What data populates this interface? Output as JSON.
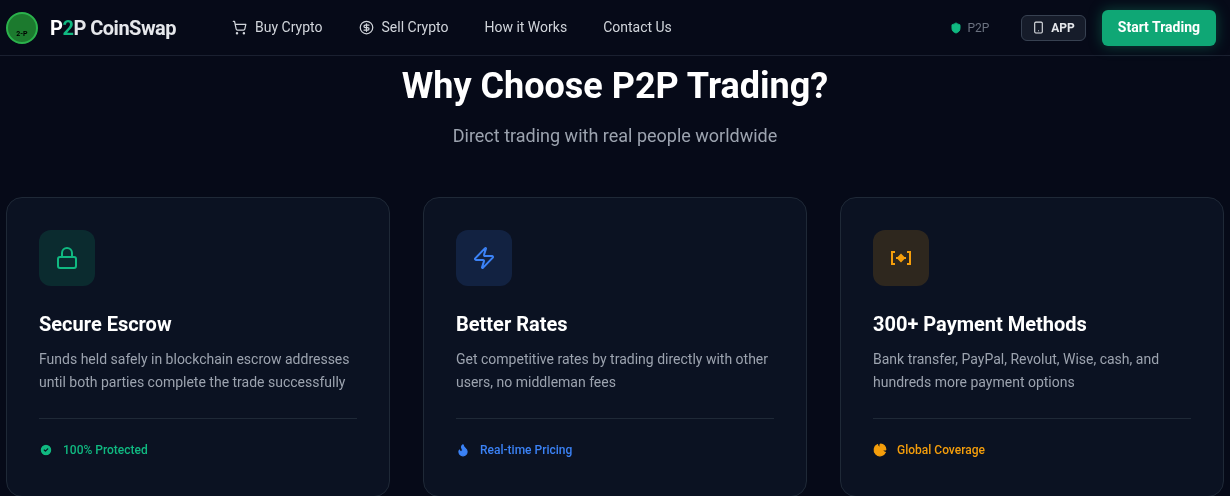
{
  "brand": {
    "logo_text": "2-P",
    "name_start": "P",
    "name_accent": "2",
    "name_end": "P CoinSwap"
  },
  "nav": [
    {
      "label": "Buy Crypto",
      "kind": "cart"
    },
    {
      "label": "Sell Crypto",
      "kind": "dollar"
    },
    {
      "label": "How it Works",
      "kind": "none"
    },
    {
      "label": "Contact Us",
      "kind": "none"
    }
  ],
  "badge": "P2P",
  "app_button": "APP",
  "cta": "Start Trading",
  "heading": "Why Choose P2P Trading?",
  "subheading": "Direct trading with real people worldwide",
  "cards": [
    {
      "kind": "lock",
      "color": "#10b981",
      "title": "Secure Escrow",
      "text": "Funds held safely in blockchain escrow addresses until both parties complete the trade successfully",
      "footer": "100% Protected"
    },
    {
      "kind": "bolt",
      "color": "#3b82f6",
      "title": "Better Rates",
      "text": "Get competitive rates by trading directly with other users, no middleman fees",
      "footer": "Real-time Pricing"
    },
    {
      "kind": "exchange",
      "color": "#f59e0b",
      "title": "300+ Payment Methods",
      "text": "Bank transfer, PayPal, Revolut, Wise, cash, and hundreds more payment options",
      "footer": "Global Coverage"
    }
  ]
}
